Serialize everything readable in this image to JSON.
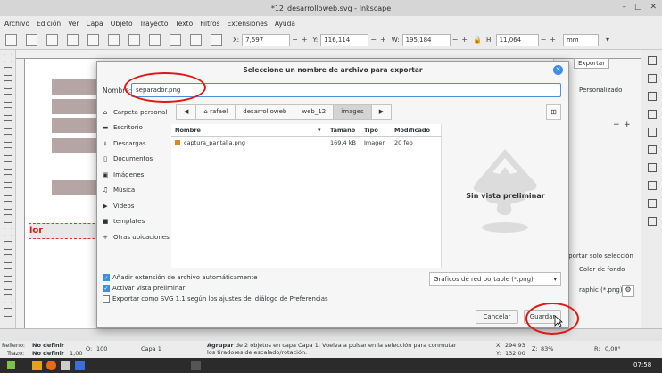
{
  "window": {
    "title": "*12_desarrolloweb.svg - Inkscape"
  },
  "menu": [
    "Archivo",
    "Edición",
    "Ver",
    "Capa",
    "Objeto",
    "Trayecto",
    "Texto",
    "Filtros",
    "Extensiones",
    "Ayuda"
  ],
  "toolbar": {
    "x_label": "X:",
    "x_value": "7,597",
    "y_label": "Y:",
    "y_value": "116,114",
    "w_label": "W:",
    "w_value": "195,184",
    "h_label": "H:",
    "h_value": "11,064",
    "unit": "mm"
  },
  "canvas": {
    "red_text": "lor"
  },
  "right_panel": {
    "export_tab": "Exportar",
    "custom": "Personalizado",
    "only_selection": "xportar solo selección",
    "bg_color": "Color de fondo",
    "format": "raphic (*.png)"
  },
  "dialog": {
    "title": "Seleccione un nombre de archivo para exportar",
    "name_label": "Nombre:",
    "name_value": "separador.png",
    "places": [
      {
        "label": "Carpeta personal",
        "icon": "home-icon"
      },
      {
        "label": "Escritorio",
        "icon": "desktop-icon"
      },
      {
        "label": "Descargas",
        "icon": "download-icon"
      },
      {
        "label": "Documentos",
        "icon": "document-icon"
      },
      {
        "label": "Imágenes",
        "icon": "image-icon"
      },
      {
        "label": "Música",
        "icon": "music-icon"
      },
      {
        "label": "Vídeos",
        "icon": "video-icon"
      },
      {
        "label": "templates",
        "icon": "folder-icon"
      },
      {
        "label": "Otras ubicaciones",
        "icon": "plus-icon"
      }
    ],
    "breadcrumbs": [
      "rafael",
      "desarrolloweb",
      "web_12",
      "images"
    ],
    "columns": {
      "name": "Nombre",
      "size": "Tamaño",
      "type": "Tipo",
      "modified": "Modificado"
    },
    "files": [
      {
        "name": "captura_pantalla.png",
        "size": "169,4 kB",
        "type": "Imagen",
        "modified": "20 feb"
      }
    ],
    "preview_text": "Sin vista preliminar",
    "options": [
      {
        "label": "Añadir extensión de archivo automáticamente",
        "checked": true
      },
      {
        "label": "Activar vista preliminar",
        "checked": true
      },
      {
        "label": "Exportar como SVG 1.1 según los ajustes del diálogo de Preferencias",
        "checked": false
      }
    ],
    "format": "Gráficos de red portable (*.png)",
    "cancel": "Cancelar",
    "save": "Guardar"
  },
  "status": {
    "fill_label": "Relleno:",
    "fill_value": "No definir",
    "stroke_label": "Trazo:",
    "stroke_value": "No definir",
    "stroke_width": "1,00",
    "opacity_label": "O:",
    "opacity_value": "100",
    "layer": "Capa 1",
    "message_bold": "Agrupar",
    "message": " de 2 objetos en capa Capa 1. Vuelva a pulsar en la selección para conmutar los tiradores de escalado/rotación.",
    "cx_label": "X:",
    "cx": "294,93",
    "cy_label": "Y:",
    "cy": "132,00",
    "zoom_label": "Z:",
    "zoom": "83%",
    "rot_label": "R:",
    "rot": "0,00°"
  },
  "taskbar": {
    "time": "07:58"
  }
}
